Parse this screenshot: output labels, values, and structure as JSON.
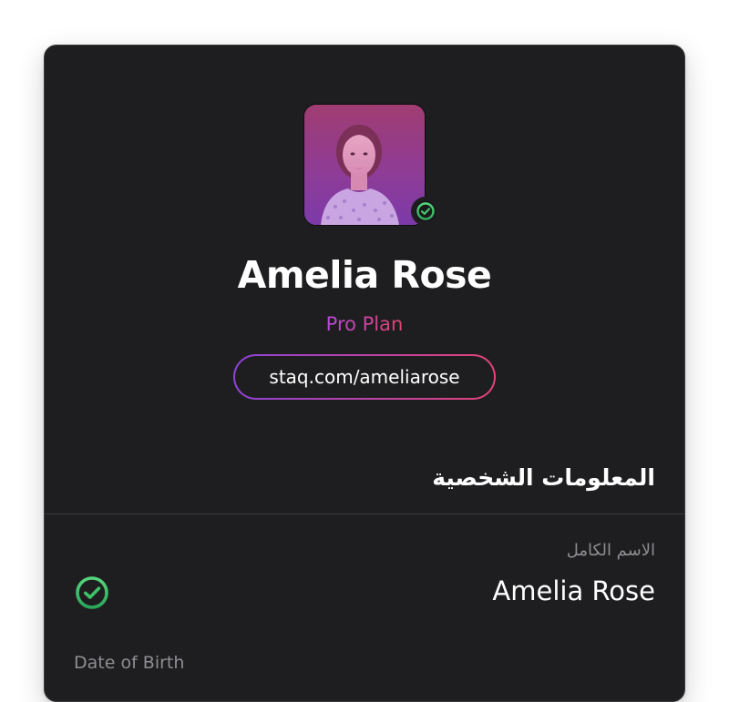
{
  "profile": {
    "name": "Amelia Rose",
    "plan": "Pro Plan",
    "link": "staq.com/ameliarose",
    "avatar_icon": "portrait-photo",
    "verified_icon": "check-circle-icon"
  },
  "personal_info": {
    "title": "المعلومات الشخصية",
    "fields": [
      {
        "label": "الاسم الكامل",
        "value": "Amelia Rose",
        "verified": true
      },
      {
        "label": "Date of Birth"
      }
    ]
  },
  "colors": {
    "card_bg": "#1e1e20",
    "accent_start": "#8f43d8",
    "accent_end": "#e34377",
    "verified_green": "#3fcf6e",
    "muted_text": "#8e8e93"
  }
}
